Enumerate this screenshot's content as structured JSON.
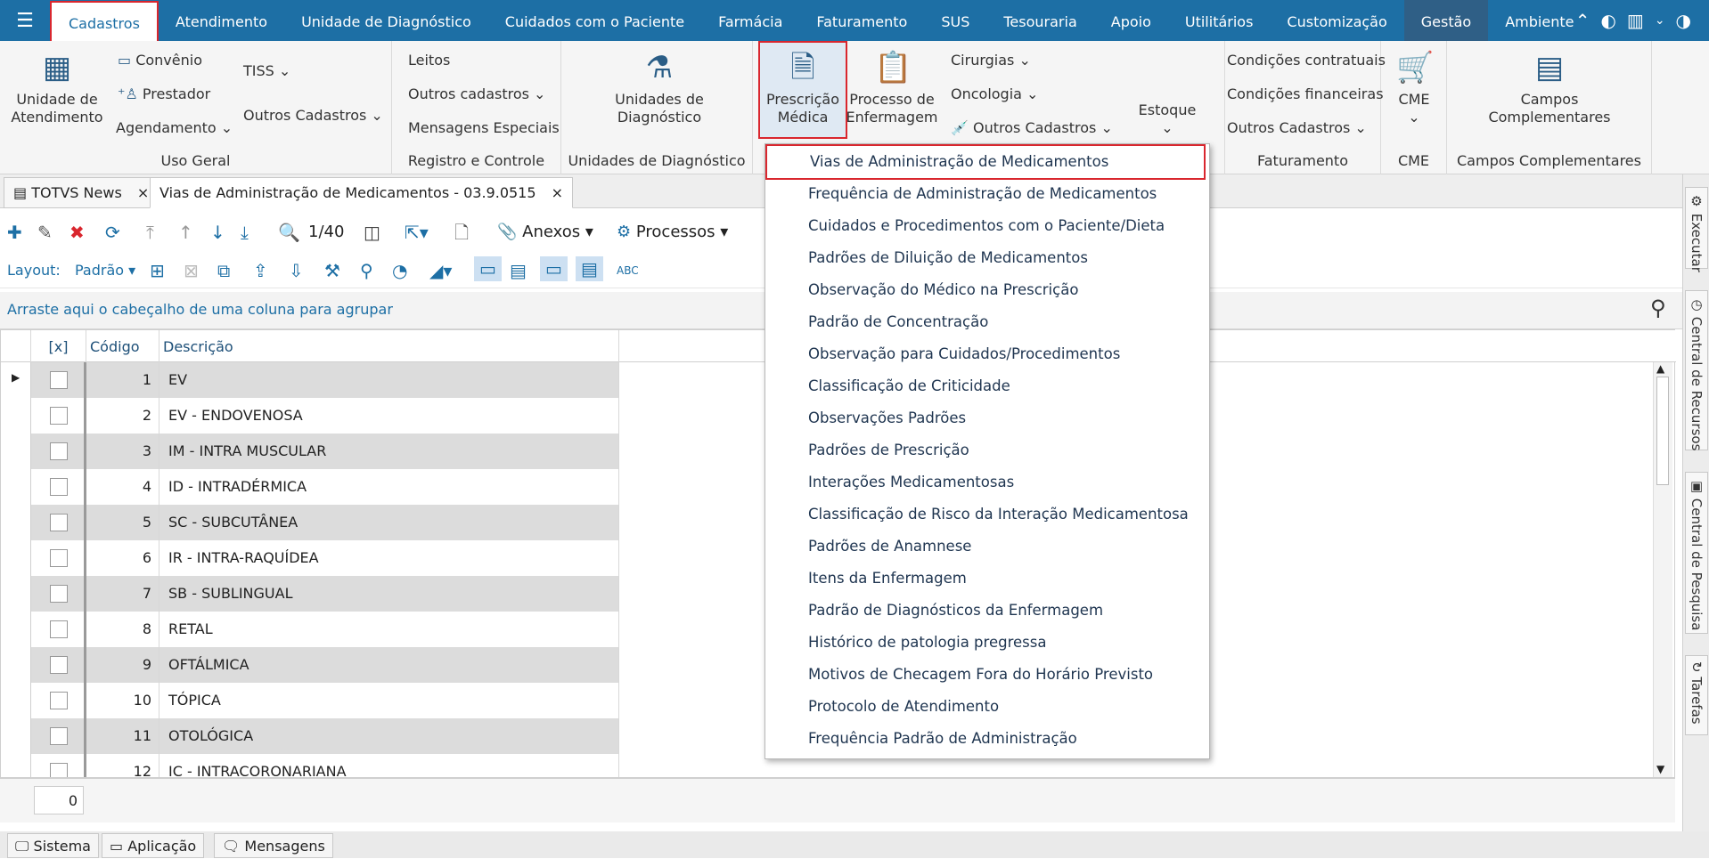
{
  "topbar": {
    "menu": [
      "Cadastros",
      "Atendimento",
      "Unidade de Diagnóstico",
      "Cuidados com o Paciente",
      "Farmácia",
      "Faturamento",
      "SUS",
      "Tesouraria",
      "Apoio",
      "Utilitários",
      "Customização",
      "Gestão",
      "Ambiente"
    ],
    "active_index": 0
  },
  "ribbon": {
    "uso_geral": {
      "label": "Uso Geral",
      "unidade": "Unidade de\nAtendimento",
      "convenio": "Convênio",
      "prestador": "Prestador",
      "agendamento": "Agendamento",
      "tiss": "TISS",
      "outros": "Outros Cadastros"
    },
    "registro": {
      "label": "Registro e Controle",
      "leitos": "Leitos",
      "outros": "Outros cadastros",
      "mensagens": "Mensagens Especiais"
    },
    "unidades_diag": {
      "label": "Unidades de Diagnóstico",
      "button": "Unidades de\nDiagnóstico"
    },
    "prescricao": {
      "button": "Prescrição\nMédica"
    },
    "processo": {
      "button": "Processo de\nEnfermagem"
    },
    "cirurgias": "Cirurgias",
    "oncologia": "Oncologia",
    "outros_cad": "Outros Cadastros",
    "estoque": "Estoque",
    "faturamento": {
      "label": "Faturamento",
      "cond_contratuais": "Condições contratuais",
      "cond_financeiras": "Condições financeiras",
      "outros": "Outros Cadastros"
    },
    "cme": {
      "label": "CME",
      "button": "CME"
    },
    "campos": {
      "label": "Campos Complementares",
      "button": "Campos\nComplementares"
    }
  },
  "doctabs": [
    {
      "label": "TOTVS News"
    },
    {
      "label": "Vias de Administração de Medicamentos - 03.9.0515"
    }
  ],
  "toolbar": {
    "page": "1/40",
    "anexos": "Anexos",
    "processos": "Processos",
    "layout_label": "Layout:",
    "layout_value": "Padrão"
  },
  "groupbar": {
    "hint": "Arraste aqui o cabeçalho de uma coluna para agrupar"
  },
  "grid": {
    "headers": {
      "check": "[x]",
      "code": "Código",
      "desc": "Descrição"
    },
    "rows": [
      {
        "code": "1",
        "desc": "EV"
      },
      {
        "code": "2",
        "desc": "EV - ENDOVENOSA"
      },
      {
        "code": "3",
        "desc": "IM - INTRA MUSCULAR"
      },
      {
        "code": "4",
        "desc": "ID - INTRADÉRMICA"
      },
      {
        "code": "5",
        "desc": "SC - SUBCUTÂNEA"
      },
      {
        "code": "6",
        "desc": "IR - INTRA-RAQUÍDEA"
      },
      {
        "code": "7",
        "desc": "SB - SUBLINGUAL"
      },
      {
        "code": "8",
        "desc": "RETAL"
      },
      {
        "code": "9",
        "desc": "OFTÁLMICA"
      },
      {
        "code": "10",
        "desc": "TÓPICA"
      },
      {
        "code": "11",
        "desc": "OTOLÓGICA"
      },
      {
        "code": "12",
        "desc": "IC - INTRACORONARIANA"
      }
    ],
    "footer_count": "0"
  },
  "dropdown": [
    "Vias de Administração de Medicamentos",
    "Frequência de Administração de Medicamentos",
    "Cuidados e Procedimentos com o Paciente/Dieta",
    "Padrões de Diluição de Medicamentos",
    "Observação do Médico na Prescrição",
    "Padrão de Concentração",
    "Observação para Cuidados/Procedimentos",
    "Classificação de Criticidade",
    "Observações Padrões",
    "Padrões de Prescrição",
    "Interações Medicamentosas",
    "Classificação de Risco da Interação Medicamentosa",
    "Padrões de Anamnese",
    "Itens da Enfermagem",
    "Padrão de Diagnósticos da Enfermagem",
    "Histórico de patologia pregressa",
    "Motivos de Checagem Fora do Horário Previsto",
    "Protocolo de Atendimento",
    "Frequência Padrão de Administração"
  ],
  "sidepanel": [
    "Executar",
    "Central de Recursos",
    "Central de Pesquisa",
    "Tarefas"
  ],
  "statusbar": [
    "Sistema",
    "Aplicação",
    "Mensagens"
  ]
}
